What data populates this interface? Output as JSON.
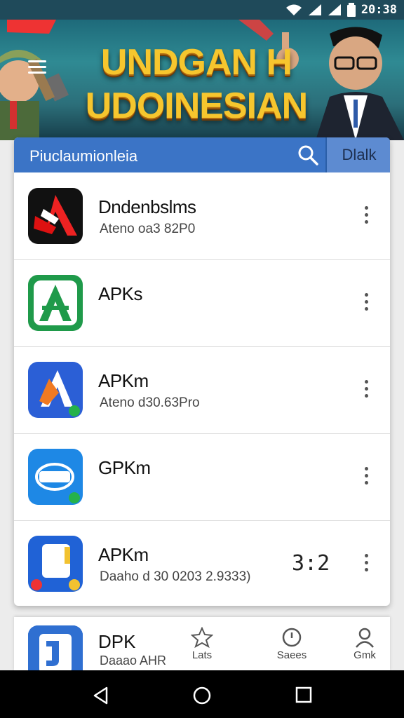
{
  "status": {
    "time": "20:38"
  },
  "banner": {
    "line1": "UNDGAN H",
    "line2": "UDOINESIAN"
  },
  "search": {
    "text": "Piuclaumionleia",
    "filter_label": "Dlalk"
  },
  "apps": [
    {
      "name": "Dndenbslms",
      "sub": "Ateno oa3 82P0",
      "rating": "",
      "icon": "red-triangle-app-icon"
    },
    {
      "name": "APKs",
      "sub": "",
      "rating": "",
      "icon": "green-apk-app-icon"
    },
    {
      "name": "APKm",
      "sub": "Ateno d30.63Pro",
      "rating": "",
      "icon": "blue-triangle-app-icon"
    },
    {
      "name": "GPKm",
      "sub": "",
      "rating": "",
      "icon": "apm-badge-app-icon"
    },
    {
      "name": "APKm",
      "sub": "Daaho d 30 0203 2.9333)",
      "rating": "3:2",
      "icon": "blue-document-app-icon"
    }
  ],
  "bottom": {
    "name": "DPK",
    "sub": "Daaao AHR",
    "nav": [
      {
        "label": "Lats",
        "icon": "star-icon"
      },
      {
        "label": "Saees",
        "icon": "clock-icon"
      },
      {
        "label": "Gmk",
        "icon": "profile-icon"
      }
    ]
  },
  "colors": {
    "accent": "#3b74c6",
    "banner_text": "#f6c62e"
  }
}
